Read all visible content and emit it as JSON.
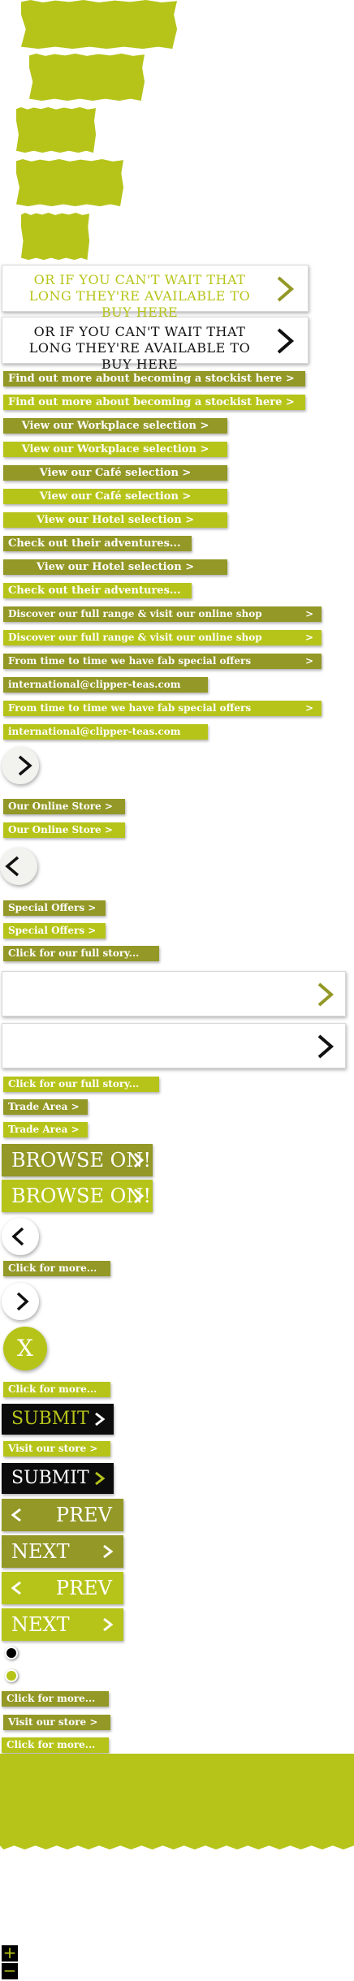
{
  "wide_cards": {
    "buy_here_1": "OR IF YOU CAN'T WAIT THAT LONG THEY'RE AVAILABLE TO BUY HERE",
    "buy_here_2": "OR IF YOU CAN'T WAIT THAT LONG THEY'RE AVAILABLE TO BUY HERE"
  },
  "buttons": {
    "stockist_1": "Find out more about becoming a stockist here >",
    "stockist_2": "Find out more about becoming a stockist here >",
    "workplace_1": "View our Workplace selection >",
    "workplace_2": "View our Workplace selection >",
    "cafe_1": "View our Café selection >",
    "cafe_2": "View our Café selection >",
    "hotel_1": "View our Hotel selection >",
    "adventures_1": "Check out their adventures...",
    "hotel_2": "View our Hotel selection >",
    "adventures_2": "Check out their adventures...",
    "discover_1": "Discover our full range & visit our online shop",
    "discover_1_arrow": ">",
    "discover_2": "Discover our full range & visit our online shop",
    "discover_2_arrow": ">",
    "fab_1": "From time to time we have fab special offers",
    "fab_1_arrow": ">",
    "email_1": "international@clipper-teas.com",
    "fab_2": "From time to time we have fab special offers",
    "fab_2_arrow": ">",
    "email_2": "international@clipper-teas.com",
    "online_store_1": "Our Online Store >",
    "online_store_2": "Our Online Store >",
    "special_1": "Special Offers >",
    "special_2": "Special Offers >",
    "story_1": "Click for our full story...",
    "story_2": "Click for our full story...",
    "trade_1": "Trade Area >",
    "trade_2": "Trade Area >",
    "browse_1": "BROWSE ON!",
    "browse_2": "BROWSE ON!",
    "more_1": "Click for more...",
    "close": "X",
    "more_2": "Click for more...",
    "submit_1": "SUBMIT",
    "visit_store_1": "Visit our store >",
    "submit_2": "SUBMIT",
    "prev_1": "PREV",
    "next_1": "NEXT",
    "prev_2": "PREV",
    "next_2": "NEXT",
    "more_3": "Click for more...",
    "visit_store_2": "Visit our store >",
    "more_4": "Click for more..."
  },
  "zoom": {
    "plus": "+",
    "minus": "−"
  },
  "colors": {
    "lime": "#b6c41a",
    "olive": "#939826",
    "black": "#0c0c0c"
  }
}
